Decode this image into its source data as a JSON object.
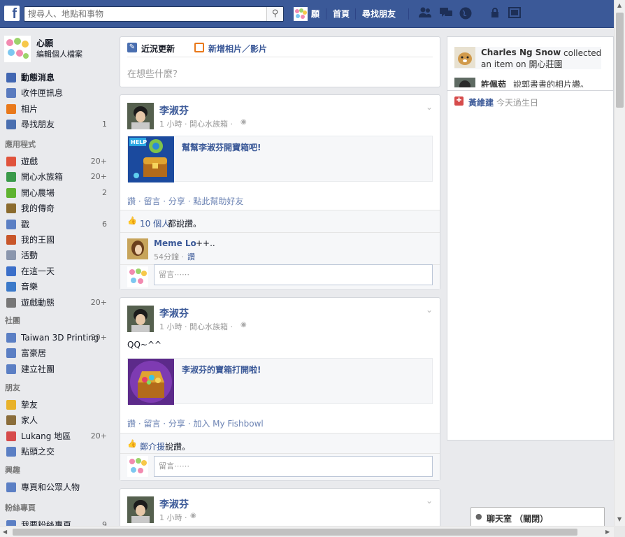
{
  "topbar": {
    "logo": "f",
    "search_placeholder": "搜尋人、地點和事物",
    "profile_name": "願",
    "home": "首頁",
    "find_friends": "尋找朋友"
  },
  "profile": {
    "name": "心願",
    "edit": "編輯個人檔案"
  },
  "favorites": [
    {
      "label": "動態消息",
      "count": "",
      "color": "#4267b2",
      "icon": "news-feed-icon"
    },
    {
      "label": "收件匣訊息",
      "count": "",
      "color": "#5a7bbf",
      "icon": "messages-icon"
    },
    {
      "label": "相片",
      "count": "",
      "color": "#e9791b",
      "icon": "photos-icon"
    },
    {
      "label": "尋找朋友",
      "count": "1",
      "color": "#4a6fb0",
      "icon": "find-friends-icon"
    }
  ],
  "apps_header": "應用程式",
  "apps": [
    {
      "label": "遊戲",
      "count": "20+",
      "color": "#e0533c",
      "icon": "games-icon"
    },
    {
      "label": "開心水族箱",
      "count": "20+",
      "color": "#3a9a4a",
      "icon": "fishbowl-icon"
    },
    {
      "label": "開心農場",
      "count": "2",
      "color": "#5fb330",
      "icon": "farm-icon"
    },
    {
      "label": "我的傳奇",
      "count": "",
      "color": "#8b6b2e",
      "icon": "legend-icon"
    },
    {
      "label": "戳",
      "count": "6",
      "color": "#5b7fc4",
      "icon": "poke-icon"
    },
    {
      "label": "我的王國",
      "count": "",
      "color": "#c8562a",
      "icon": "kingdom-icon"
    },
    {
      "label": "活動",
      "count": "",
      "color": "#8a96ad",
      "icon": "events-icon"
    },
    {
      "label": "在這一天",
      "count": "",
      "color": "#3b6fc9",
      "icon": "on-this-day-icon"
    },
    {
      "label": "音樂",
      "count": "",
      "color": "#3b79c9",
      "icon": "music-icon"
    },
    {
      "label": "遊戲動態",
      "count": "20+",
      "color": "#777777",
      "icon": "games-feed-icon"
    }
  ],
  "groups_header": "社團",
  "groups": [
    {
      "label": "Taiwan 3D Printing",
      "count": "20+",
      "color": "#5b7fc4",
      "icon": "group-icon"
    },
    {
      "label": "富豪居",
      "count": "",
      "color": "#5b7fc4",
      "icon": "group-icon"
    },
    {
      "label": "建立社團",
      "count": "",
      "color": "#5b7fc4",
      "icon": "create-group-icon"
    }
  ],
  "friends_header": "朋友",
  "friends": [
    {
      "label": "摯友",
      "count": "",
      "color": "#e8b22b",
      "icon": "star-icon"
    },
    {
      "label": "家人",
      "count": "",
      "color": "#8a6d3b",
      "icon": "home-icon"
    },
    {
      "label": "Lukang 地區",
      "count": "20+",
      "color": "#d64b4b",
      "icon": "location-icon"
    },
    {
      "label": "點頭之交",
      "count": "",
      "color": "#5b7fc4",
      "icon": "acquaintances-icon"
    }
  ],
  "interests_header": "興趣",
  "interests": [
    {
      "label": "專頁和公眾人物",
      "count": "",
      "color": "#5b7fc4",
      "icon": "pages-icon"
    }
  ],
  "fanpages_header": "粉絲專頁",
  "fanpages": [
    {
      "label": "我要粉絲專頁",
      "count": "9",
      "color": "#5b7fc4",
      "icon": "fan-page-icon"
    }
  ],
  "composer": {
    "tab_status": "近況更新",
    "tab_photo": "新增相片／影片",
    "placeholder": "在想些什麼？"
  },
  "posts": [
    {
      "name": "李淑芬",
      "meta": "1 小時 · 開心水族箱 ·",
      "body": "",
      "attachment_title": "幫幫李淑芬開寶箱吧!",
      "actions": "讚 · 留言 · 分享 · 點此幫助好友",
      "likes_count": "10 個人",
      "likes_suffix": "都說讚。",
      "comment": {
        "name": "Meme Lo",
        "text": "++..",
        "time": "54分鐘 ·",
        "like": "讚"
      },
      "comment_placeholder": "留言⋯⋯"
    },
    {
      "name": "李淑芬",
      "meta": "1 小時 · 開心水族箱 ·",
      "body": "QQ~^^",
      "attachment_title": "李淑芬的寶箱打開啦!",
      "actions": "讚 · 留言 · 分享 · 加入 My Fishbowl",
      "likes_count": "鄭介援",
      "likes_suffix": "說讚。",
      "comment_placeholder": "留言⋯⋯"
    },
    {
      "name": "李淑芬",
      "meta": "1 小時 ·"
    }
  ],
  "ticker": [
    {
      "name": "Charles Ng Snow",
      "text": "collected an item on 開心莊園"
    },
    {
      "name": "許佩茹",
      "text": "說郭書書的相片讚。"
    }
  ],
  "birthday": {
    "name": "黃維建",
    "text": "今天過生日"
  },
  "chat": {
    "label": "聊天室 （關閉）"
  }
}
